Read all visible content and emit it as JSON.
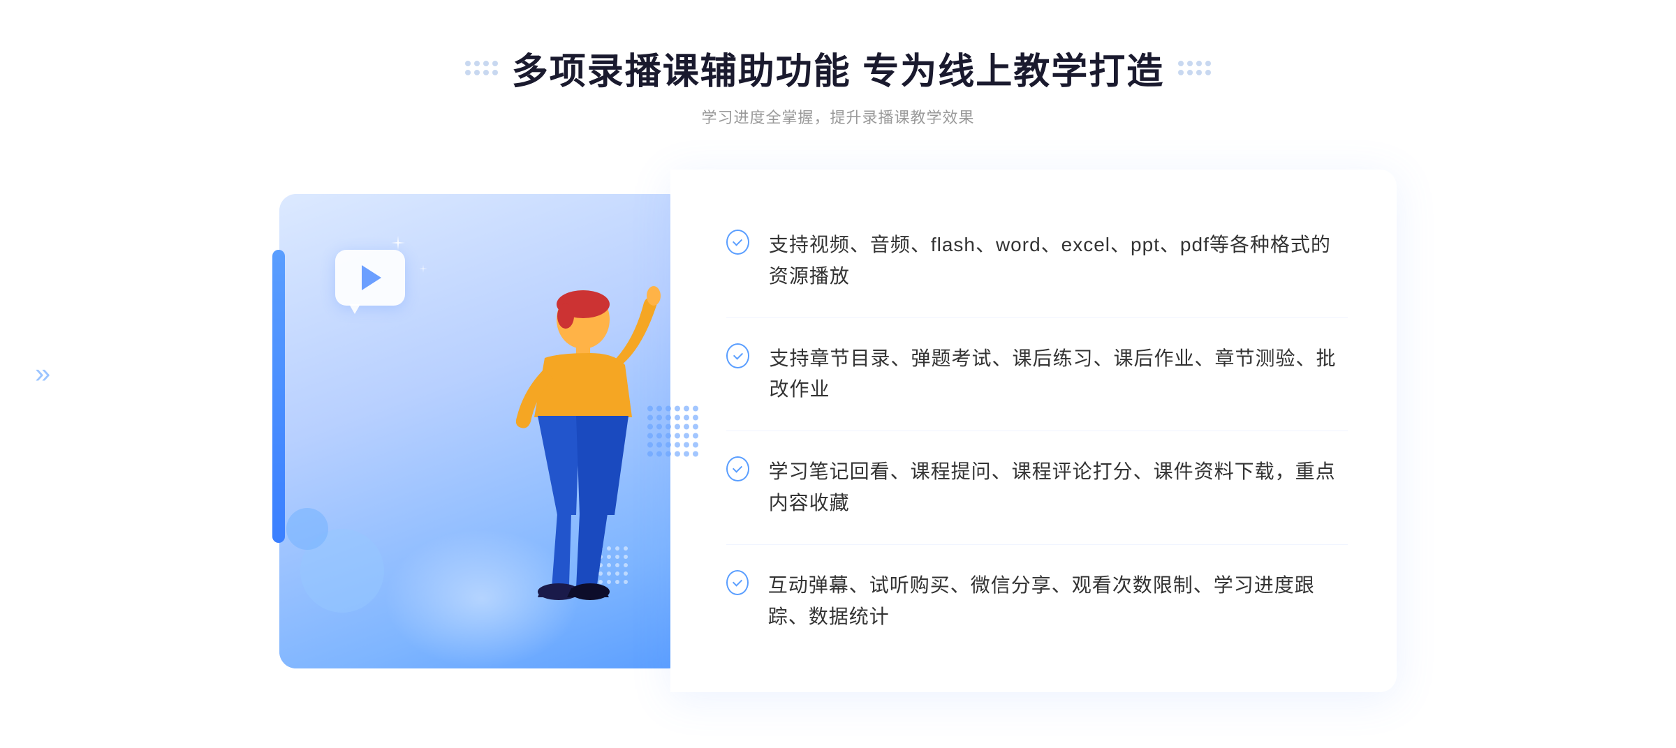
{
  "header": {
    "title": "多项录播课辅助功能 专为线上教学打造",
    "subtitle": "学习进度全掌握，提升录播课教学效果"
  },
  "features": [
    {
      "id": "feature-1",
      "text": "支持视频、音频、flash、word、excel、ppt、pdf等各种格式的资源播放"
    },
    {
      "id": "feature-2",
      "text": "支持章节目录、弹题考试、课后练习、课后作业、章节测验、批改作业"
    },
    {
      "id": "feature-3",
      "text": "学习笔记回看、课程提问、课程评论打分、课件资料下载，重点内容收藏"
    },
    {
      "id": "feature-4",
      "text": "互动弹幕、试听购买、微信分享、观看次数限制、学习进度跟踪、数据统计"
    }
  ],
  "decorative": {
    "chevron_left": "»",
    "accent_color": "#4a8fff",
    "light_blue": "#e8f2ff"
  }
}
